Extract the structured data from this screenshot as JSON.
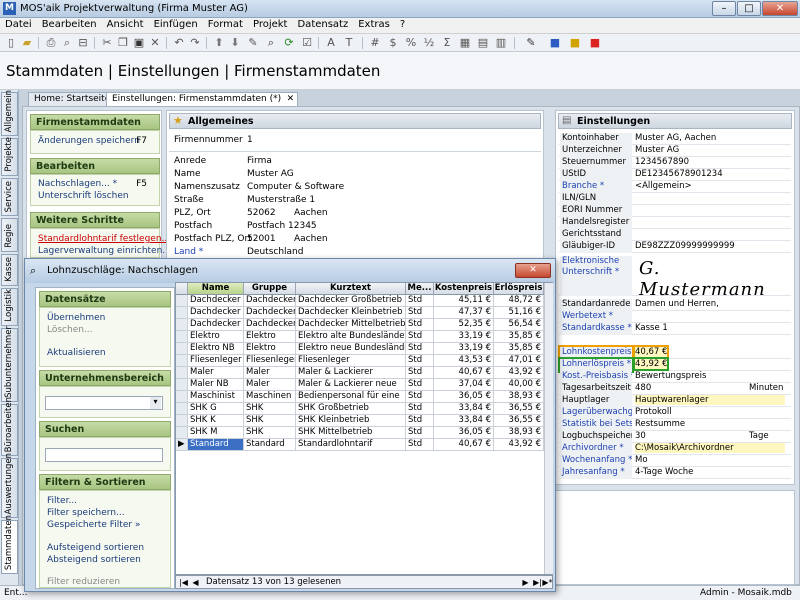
{
  "window": {
    "title": "MOS'aik Projektverwaltung (Firma Muster AG)",
    "controls": [
      "–",
      "□",
      "✕"
    ]
  },
  "menu": [
    "Datei",
    "Bearbeiten",
    "Ansicht",
    "Einfügen",
    "Format",
    "Projekt",
    "Datensatz",
    "Extras",
    "?"
  ],
  "page_title": "Stammdaten | Einstellungen | Firmenstammdaten",
  "side_tabs": [
    "Allgemein",
    "Projekte",
    "Service",
    "Regie",
    "Kasse",
    "Logistik",
    "Subunternehmer",
    "Büroarbeiten",
    "Auswertungen",
    "Stammdaten"
  ],
  "doc_tabs": [
    "Home: Startseite",
    "Einstellungen: Firmenstammdaten (*)",
    "✕"
  ],
  "left": {
    "sec1": "Firmenstammdaten",
    "save": "Änderungen speichern",
    "save_key": "F7",
    "sec2": "Bearbeiten",
    "lookup": "Nachschlagen... *",
    "lookup_key": "F5",
    "del_sig": "Unterschrift löschen",
    "sec3": "Weitere Schritte",
    "tarif": "Standardlohntarif festlegen...",
    "lager": "Lagerverwaltung einrichten..."
  },
  "general": {
    "header": "Allgemeines",
    "firmennummer_lbl": "Firmennummer",
    "firmennummer": "1",
    "anrede_lbl": "Anrede",
    "anrede": "Firma",
    "name_lbl": "Name",
    "name": "Muster AG",
    "zusatz_lbl": "Namenszusatz",
    "zusatz": "Computer & Software",
    "strasse_lbl": "Straße",
    "strasse": "Musterstraße 1",
    "plzort_lbl": "PLZ, Ort",
    "plz": "52062",
    "ort": "Aachen",
    "postfach_lbl": "Postfach",
    "postfach": "Postfach 12345",
    "postfachplz_lbl": "Postfach PLZ, Ort",
    "postfachplz": "52001",
    "postfachort": "Aachen",
    "land_lbl": "Land *",
    "land": "Deutschland"
  },
  "settings": {
    "header": "Einstellungen",
    "rows1": [
      {
        "label": "Kontoinhaber",
        "value": "Muster AG, Aachen"
      },
      {
        "label": "Unterzeichner",
        "value": "Muster AG"
      },
      {
        "label": "Steuernummer",
        "value": "1234567890"
      },
      {
        "label": "UStID",
        "value": "DE12345678901234"
      },
      {
        "label": "Branche *",
        "value": "<Allgemein>"
      },
      {
        "label": "ILN/GLN",
        "value": ""
      },
      {
        "label": "EORI Nummer",
        "value": ""
      },
      {
        "label": "Handelsregister",
        "value": ""
      },
      {
        "label": "Gerichtsstand",
        "value": ""
      },
      {
        "label": "Gläubiger-ID",
        "value": "DE98ZZZ09999999999"
      }
    ],
    "sig_label": "Elektronische Unterschrift *",
    "signature": "G. Mustermann",
    "rows2": [
      {
        "label": "Standardanrede",
        "value": "Damen und Herren,"
      },
      {
        "label": "Werbetext *",
        "value": ""
      },
      {
        "label": "Standardkasse *",
        "value": "Kasse 1"
      }
    ],
    "rows3": [
      {
        "label": "Lohnkostenpreis *",
        "value": "40,67 €"
      },
      {
        "label": "Lohnerlöspreis *",
        "value": "43,92 €"
      },
      {
        "label": "Kost.-Preisbasis *",
        "value": "Bewertungspreis"
      },
      {
        "label": "Tagesarbeitszeit",
        "value": "480",
        "unit": "Minuten"
      },
      {
        "label": "Hauptlager",
        "value": "Hauptwarenlager"
      },
      {
        "label": "Lagerüberwachg *",
        "value": "Protokoll"
      },
      {
        "label": "Statistik bei Sets *",
        "value": "Restsumme"
      },
      {
        "label": "Logbuchspeicher",
        "value": "30",
        "unit": "Tage"
      },
      {
        "label": "Archivordner *",
        "value": "C:\\Mosaik\\Archivordner"
      },
      {
        "label": "Wochenanfang *",
        "value": "Mo"
      },
      {
        "label": "Jahresanfang *",
        "value": "4-Tage Woche"
      }
    ]
  },
  "status": {
    "left": "Ent...",
    "user": "Admin - Mosaik.mdb"
  },
  "dialog": {
    "title": "Lohnzuschläge: Nachschlagen",
    "sec1": "Datensätze",
    "take": "Übernehmen",
    "delete": "Löschen...",
    "refresh": "Aktualisieren",
    "sec2": "Unternehmensbereich",
    "sec3": "Suchen",
    "sec4": "Filtern & Sortieren",
    "filter": "Filter...",
    "save_filter": "Filter speichern...",
    "saved_filter": "Gespeicherte Filter »",
    "asc": "Aufsteigend sortieren",
    "desc": "Absteigend sortieren",
    "reduce": "Filter reduzieren",
    "columns": [
      "Name",
      "Gruppe",
      "Kurztext",
      "Me...",
      "Kostenpreis",
      "Erlöspreis"
    ],
    "rows": [
      [
        "Dachdecker G",
        "Dachdecker",
        "Dachdecker Großbetrieb",
        "Std",
        "45,11 €",
        "48,72 €"
      ],
      [
        "Dachdecker K",
        "Dachdecker",
        "Dachdecker Kleinbetrieb",
        "Std",
        "47,37 €",
        "51,16 €"
      ],
      [
        "Dachdecker M",
        "Dachdecker",
        "Dachdecker Mittelbetrieb",
        "Std",
        "52,35 €",
        "56,54 €"
      ],
      [
        "Elektro",
        "Elektro",
        "Elektro alte Bundesländer",
        "Std",
        "33,19 €",
        "35,85 €"
      ],
      [
        "Elektro NB",
        "Elektro",
        "Elektro neue Bundesländer",
        "Std",
        "33,19 €",
        "35,85 €"
      ],
      [
        "Fliesenleger",
        "Fliesenleger",
        "Fliesenleger",
        "Std",
        "43,53 €",
        "47,01 €"
      ],
      [
        "Maler",
        "Maler",
        "Maler & Lackierer",
        "Std",
        "40,67 €",
        "43,92 €"
      ],
      [
        "Maler NB",
        "Maler",
        "Maler & Lackierer neue",
        "Std",
        "37,04 €",
        "40,00 €"
      ],
      [
        "Maschinist",
        "Maschinen",
        "Bedienpersonal für eine",
        "Std",
        "36,05 €",
        "38,93 €"
      ],
      [
        "SHK G",
        "SHK",
        "SHK Großbetrieb",
        "Std",
        "33,84 €",
        "36,55 €"
      ],
      [
        "SHK K",
        "SHK",
        "SHK Kleinbetrieb",
        "Std",
        "33,84 €",
        "36,55 €"
      ],
      [
        "SHK M",
        "SHK",
        "SHK Mittelbetrieb",
        "Std",
        "36,05 €",
        "38,93 €"
      ],
      [
        "Standard",
        "Standard",
        "Standardlohntarif",
        "Std",
        "40,67 €",
        "43,92 €"
      ]
    ],
    "nav_text": "Datensatz 13 von 13 gelesenen"
  }
}
